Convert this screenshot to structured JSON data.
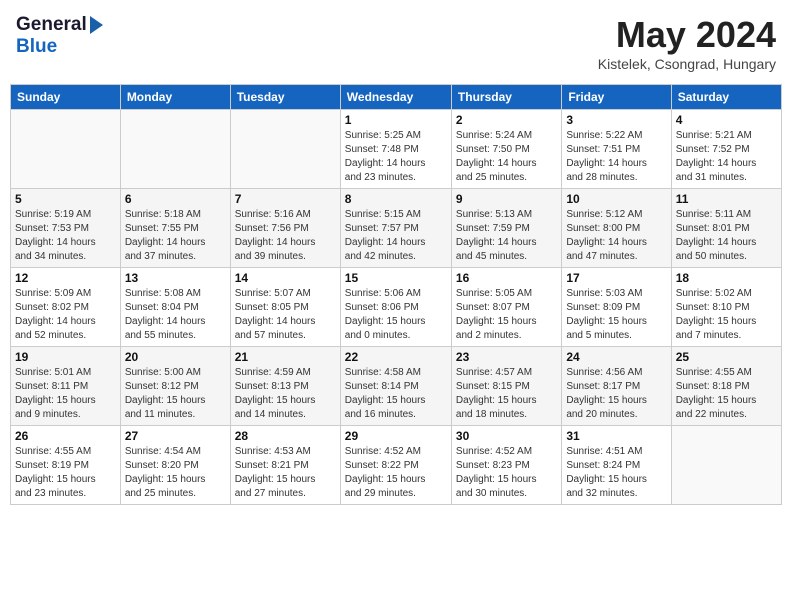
{
  "header": {
    "logo_line1": "General",
    "logo_line2": "Blue",
    "month_title": "May 2024",
    "location": "Kistelek, Csongrad, Hungary"
  },
  "days_of_week": [
    "Sunday",
    "Monday",
    "Tuesday",
    "Wednesday",
    "Thursday",
    "Friday",
    "Saturday"
  ],
  "weeks": [
    [
      {
        "day": "",
        "info": ""
      },
      {
        "day": "",
        "info": ""
      },
      {
        "day": "",
        "info": ""
      },
      {
        "day": "1",
        "info": "Sunrise: 5:25 AM\nSunset: 7:48 PM\nDaylight: 14 hours\nand 23 minutes."
      },
      {
        "day": "2",
        "info": "Sunrise: 5:24 AM\nSunset: 7:50 PM\nDaylight: 14 hours\nand 25 minutes."
      },
      {
        "day": "3",
        "info": "Sunrise: 5:22 AM\nSunset: 7:51 PM\nDaylight: 14 hours\nand 28 minutes."
      },
      {
        "day": "4",
        "info": "Sunrise: 5:21 AM\nSunset: 7:52 PM\nDaylight: 14 hours\nand 31 minutes."
      }
    ],
    [
      {
        "day": "5",
        "info": "Sunrise: 5:19 AM\nSunset: 7:53 PM\nDaylight: 14 hours\nand 34 minutes."
      },
      {
        "day": "6",
        "info": "Sunrise: 5:18 AM\nSunset: 7:55 PM\nDaylight: 14 hours\nand 37 minutes."
      },
      {
        "day": "7",
        "info": "Sunrise: 5:16 AM\nSunset: 7:56 PM\nDaylight: 14 hours\nand 39 minutes."
      },
      {
        "day": "8",
        "info": "Sunrise: 5:15 AM\nSunset: 7:57 PM\nDaylight: 14 hours\nand 42 minutes."
      },
      {
        "day": "9",
        "info": "Sunrise: 5:13 AM\nSunset: 7:59 PM\nDaylight: 14 hours\nand 45 minutes."
      },
      {
        "day": "10",
        "info": "Sunrise: 5:12 AM\nSunset: 8:00 PM\nDaylight: 14 hours\nand 47 minutes."
      },
      {
        "day": "11",
        "info": "Sunrise: 5:11 AM\nSunset: 8:01 PM\nDaylight: 14 hours\nand 50 minutes."
      }
    ],
    [
      {
        "day": "12",
        "info": "Sunrise: 5:09 AM\nSunset: 8:02 PM\nDaylight: 14 hours\nand 52 minutes."
      },
      {
        "day": "13",
        "info": "Sunrise: 5:08 AM\nSunset: 8:04 PM\nDaylight: 14 hours\nand 55 minutes."
      },
      {
        "day": "14",
        "info": "Sunrise: 5:07 AM\nSunset: 8:05 PM\nDaylight: 14 hours\nand 57 minutes."
      },
      {
        "day": "15",
        "info": "Sunrise: 5:06 AM\nSunset: 8:06 PM\nDaylight: 15 hours\nand 0 minutes."
      },
      {
        "day": "16",
        "info": "Sunrise: 5:05 AM\nSunset: 8:07 PM\nDaylight: 15 hours\nand 2 minutes."
      },
      {
        "day": "17",
        "info": "Sunrise: 5:03 AM\nSunset: 8:09 PM\nDaylight: 15 hours\nand 5 minutes."
      },
      {
        "day": "18",
        "info": "Sunrise: 5:02 AM\nSunset: 8:10 PM\nDaylight: 15 hours\nand 7 minutes."
      }
    ],
    [
      {
        "day": "19",
        "info": "Sunrise: 5:01 AM\nSunset: 8:11 PM\nDaylight: 15 hours\nand 9 minutes."
      },
      {
        "day": "20",
        "info": "Sunrise: 5:00 AM\nSunset: 8:12 PM\nDaylight: 15 hours\nand 11 minutes."
      },
      {
        "day": "21",
        "info": "Sunrise: 4:59 AM\nSunset: 8:13 PM\nDaylight: 15 hours\nand 14 minutes."
      },
      {
        "day": "22",
        "info": "Sunrise: 4:58 AM\nSunset: 8:14 PM\nDaylight: 15 hours\nand 16 minutes."
      },
      {
        "day": "23",
        "info": "Sunrise: 4:57 AM\nSunset: 8:15 PM\nDaylight: 15 hours\nand 18 minutes."
      },
      {
        "day": "24",
        "info": "Sunrise: 4:56 AM\nSunset: 8:17 PM\nDaylight: 15 hours\nand 20 minutes."
      },
      {
        "day": "25",
        "info": "Sunrise: 4:55 AM\nSunset: 8:18 PM\nDaylight: 15 hours\nand 22 minutes."
      }
    ],
    [
      {
        "day": "26",
        "info": "Sunrise: 4:55 AM\nSunset: 8:19 PM\nDaylight: 15 hours\nand 23 minutes."
      },
      {
        "day": "27",
        "info": "Sunrise: 4:54 AM\nSunset: 8:20 PM\nDaylight: 15 hours\nand 25 minutes."
      },
      {
        "day": "28",
        "info": "Sunrise: 4:53 AM\nSunset: 8:21 PM\nDaylight: 15 hours\nand 27 minutes."
      },
      {
        "day": "29",
        "info": "Sunrise: 4:52 AM\nSunset: 8:22 PM\nDaylight: 15 hours\nand 29 minutes."
      },
      {
        "day": "30",
        "info": "Sunrise: 4:52 AM\nSunset: 8:23 PM\nDaylight: 15 hours\nand 30 minutes."
      },
      {
        "day": "31",
        "info": "Sunrise: 4:51 AM\nSunset: 8:24 PM\nDaylight: 15 hours\nand 32 minutes."
      },
      {
        "day": "",
        "info": ""
      }
    ]
  ]
}
